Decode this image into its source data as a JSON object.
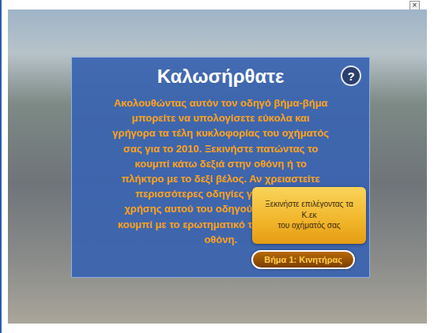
{
  "window": {
    "close": "×"
  },
  "dialog": {
    "title": "Καλωσήρθατε",
    "help": "?",
    "lines": [
      {
        "text": "Ακολουθώντας αυτόν τον οδηγό βήμα-βήμα",
        "covered": false
      },
      {
        "text": "μπορείτε να υπολογίσετε εύκολα και",
        "covered": false
      },
      {
        "text": "γρήγορα τα τέλη κυκλοφορίας του οχήματός",
        "covered": false
      },
      {
        "text": "σας για το 2010. Ξεκινήστε πατώντας το",
        "covered": false
      },
      {
        "text": "κουμπί κάτω δεξιά στην οθόνη ή το",
        "covered": false
      },
      {
        "text": "πλήκτρο με το δεξί βέλος. Αν χρειαστείτε",
        "covered": false
      },
      {
        "text": "περισσότερες οδηγίες γ",
        "covered": true
      },
      {
        "text": "χρήσης αυτού του οδηγού",
        "covered": true
      },
      {
        "text": "κουμπί με το ερωτηματικό τ",
        "covered": true
      },
      {
        "text": "οθόνη.",
        "covered": false
      }
    ],
    "tooltip": {
      "lines": [
        "Ξεκινήστε επιλέγοντας τα",
        "Κ.εκ",
        "του οχήματός σας"
      ]
    },
    "button": "Βήμα 1: Κινητήρας"
  }
}
